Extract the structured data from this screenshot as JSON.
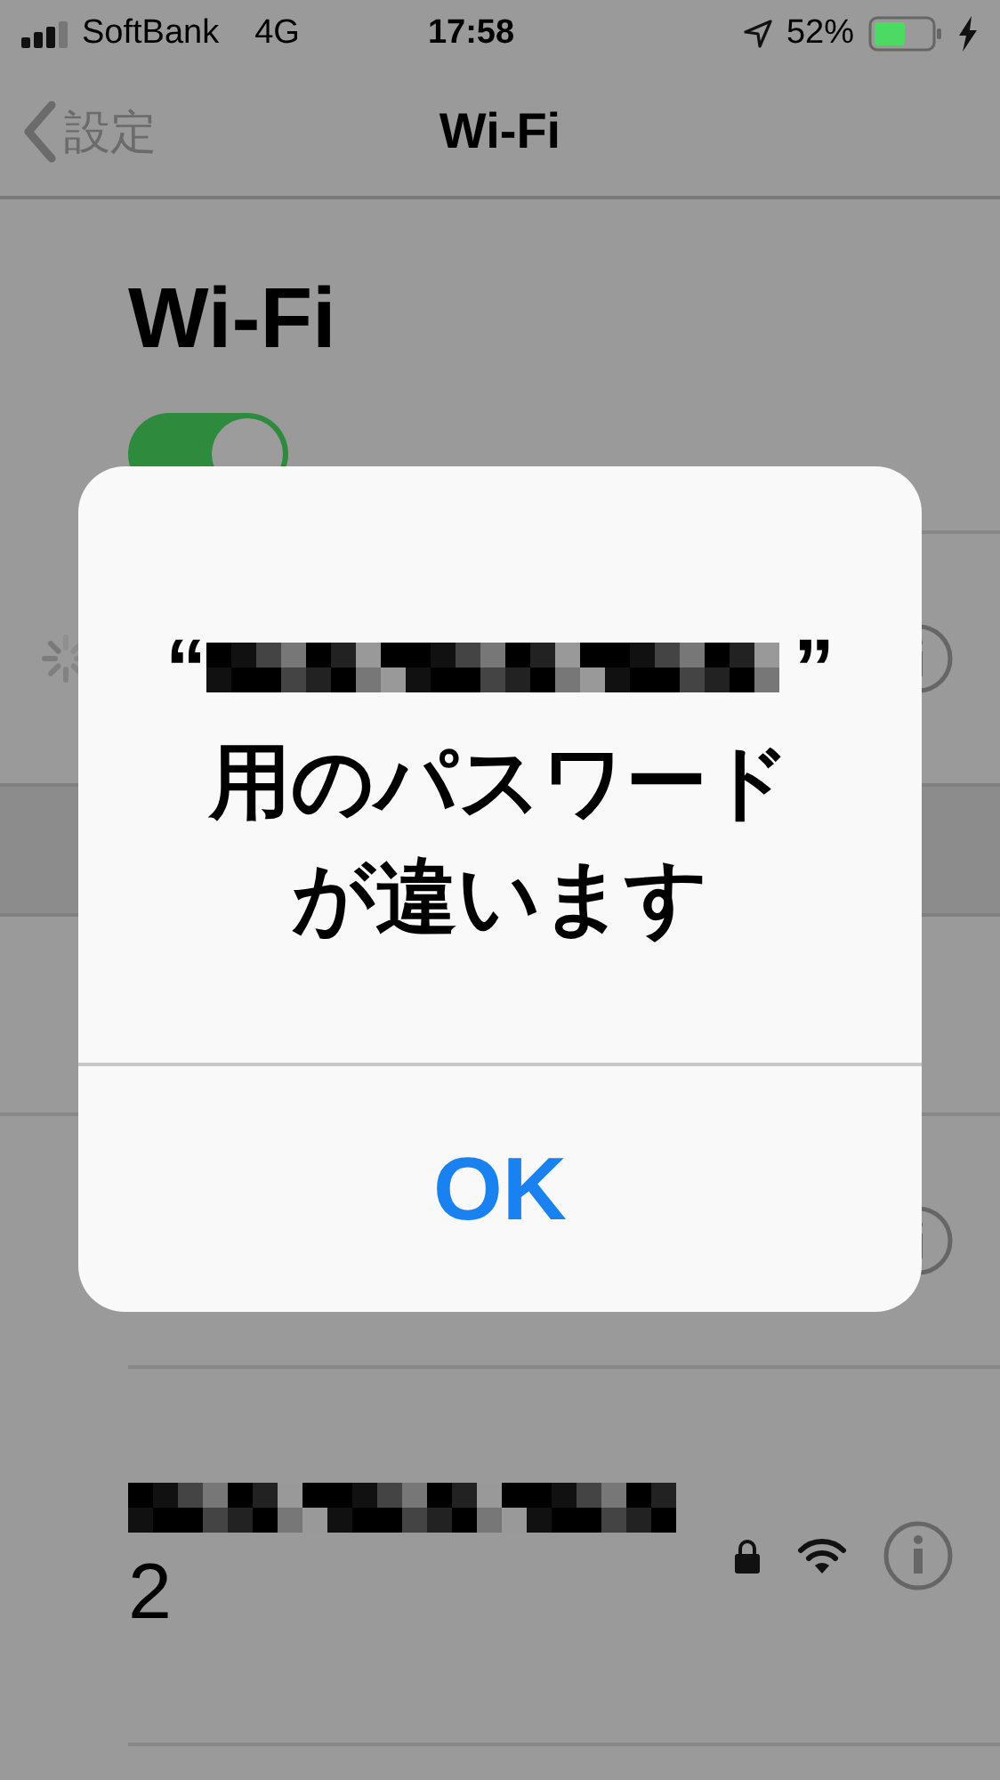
{
  "status_bar": {
    "carrier": "SoftBank",
    "network": "4G",
    "time": "17:58",
    "battery": "52%"
  },
  "nav": {
    "back": "設定",
    "title": "Wi-Fi"
  },
  "header": {
    "title": "Wi-Fi",
    "toggle_on": true
  },
  "current_network": {
    "connecting": true
  },
  "networks": [
    {
      "name_suffix": "2",
      "locked": true
    }
  ],
  "alert": {
    "quote_open": "“",
    "quote_close": "”",
    "message_lines": [
      "用のパスワード",
      "が違います"
    ],
    "button": "OK"
  }
}
